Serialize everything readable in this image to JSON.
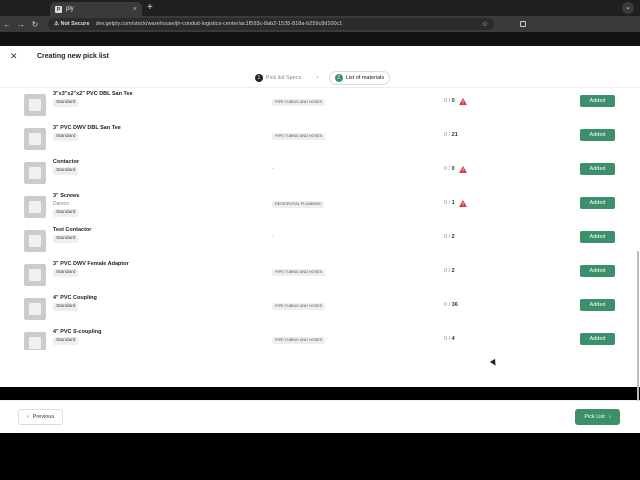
{
  "browser": {
    "tab_title": "ply",
    "favicon_letter": "p",
    "not_secure": "Not Secure",
    "url": "dev.getply.com/stock/warehouse/jlr-conduit-logistics-center/ac1f593c-8ab2-1535-818a-b259c8d100c1"
  },
  "page": {
    "title": "Creating new pick list",
    "steps": [
      {
        "num": "1",
        "label": "Pick list Specs"
      },
      {
        "num": "2",
        "label": "List of materials"
      }
    ]
  },
  "items": [
    {
      "name": "3\"x3\"x2\"x2\" PVC DBL San Tee",
      "supplier": "",
      "badge": "Standard",
      "category": "PIPE TUBING AND HOSES",
      "qty_a": "0",
      "qty_b": "0",
      "warn": true,
      "action": "Added"
    },
    {
      "name": "3\" PVC DWV DBL San Tee",
      "supplier": "",
      "badge": "Standard",
      "category": "PIPE TUBING AND HOSES",
      "qty_a": "0",
      "qty_b": "21",
      "warn": false,
      "action": "Added"
    },
    {
      "name": "Contactor",
      "supplier": "",
      "badge": "Standard",
      "category": "-",
      "qty_a": "0",
      "qty_b": "0",
      "warn": true,
      "action": "Added"
    },
    {
      "name": "3\" Screws",
      "supplier": "Damon",
      "badge": "Standard",
      "category": "RESIDENTIAL PLUMBING",
      "qty_a": "0",
      "qty_b": "1",
      "warn": true,
      "action": "Added"
    },
    {
      "name": "Test Contactor",
      "supplier": "",
      "badge": "Standard",
      "category": "-",
      "qty_a": "0",
      "qty_b": "2",
      "warn": false,
      "action": "Added"
    },
    {
      "name": "3\" PVC DWV Female Adaptor",
      "supplier": "",
      "badge": "Standard",
      "category": "PIPE TUBING AND HOSES",
      "qty_a": "0",
      "qty_b": "2",
      "warn": false,
      "action": "Added"
    },
    {
      "name": "4\" PVC Coupling",
      "supplier": "",
      "badge": "Standard",
      "category": "PIPE TUBING AND HOSES",
      "qty_a": "0",
      "qty_b": "36",
      "warn": false,
      "action": "Added"
    },
    {
      "name": "4\" PVC S-coupling",
      "supplier": "",
      "badge": "Standard",
      "category": "PIPE TUBING AND HOSES",
      "qty_a": "0",
      "qty_b": "4",
      "warn": false,
      "action": "Added"
    }
  ],
  "footer": {
    "previous_label": "Previous",
    "next_label": "Pick List"
  },
  "colors": {
    "accent": "#3b8f6a",
    "warning": "#d9343a"
  }
}
